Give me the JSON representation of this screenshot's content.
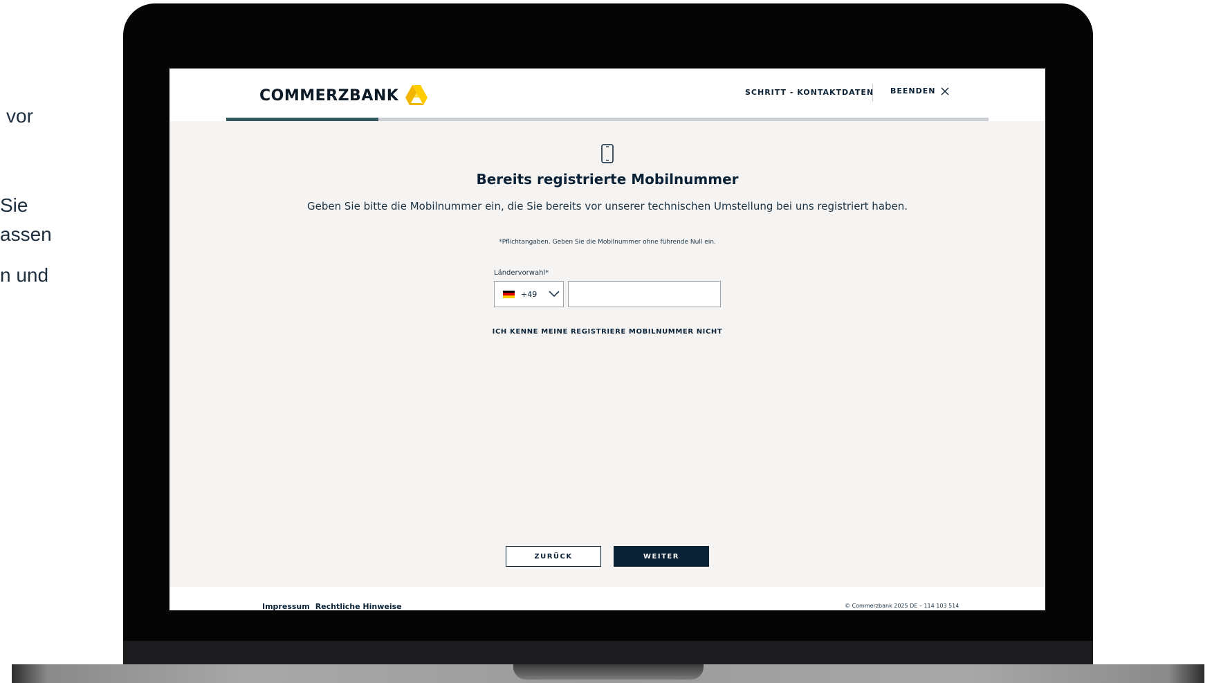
{
  "slide": {
    "text_lines": [
      "vor",
      "Sie",
      "assen",
      "n und"
    ]
  },
  "header": {
    "brand": "COMMERZBANK",
    "step_label": "SCHRITT -  KONTAKTDATEN",
    "end_label": "BEENDEN",
    "progress": 0.2
  },
  "main": {
    "title": "Bereits registrierte Mobilnummer",
    "subtitle": "Geben Sie bitte die Mobilnummer ein, die Sie bereits vor unserer technischen Umstellung bei uns registriert haben.",
    "note": "*Pflichtangaben. Geben Sie die Mobilnummer ohne führende Null ein.",
    "country_label": "Ländervorwahl*",
    "country_code": "+49",
    "phone_value": "",
    "unknown_link": "ICH KENNE MEINE REGISTRIERE MOBILNUMMER NICHT"
  },
  "actions": {
    "back_label": "ZURÜCK",
    "next_label": "WEITER"
  },
  "footer": {
    "imprint": "Impressum",
    "legal": "Rechtliche Hinweise",
    "copyright": "© Commerzbank 2025 DE – 114 103 514"
  },
  "colors": {
    "primary": "#0b2236",
    "progress": "#35585f",
    "logo_yellow": "#ffcc00",
    "screen_bg": "#f5f4f2"
  },
  "icons": {
    "phone": "smartphone-icon",
    "close": "close-icon",
    "chevron": "chevron-down-icon",
    "flag": "germany-flag-icon",
    "logo": "commerzbank-ribbon-logo"
  }
}
